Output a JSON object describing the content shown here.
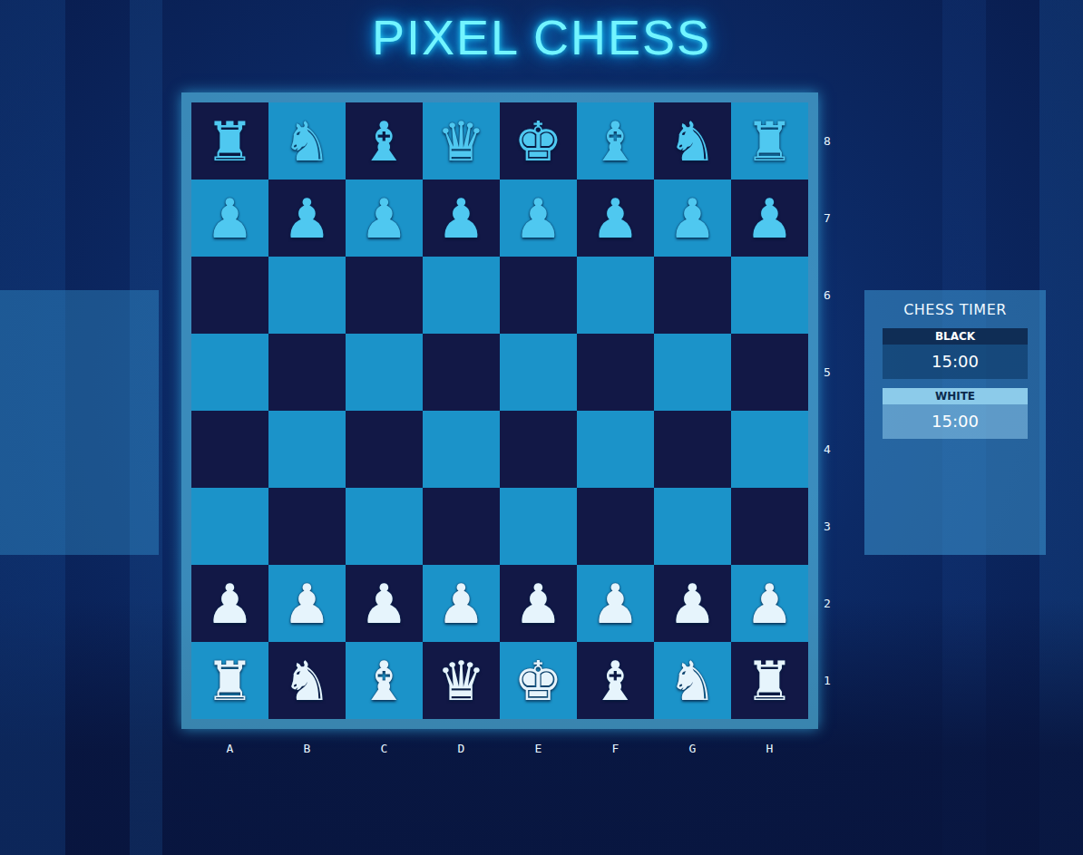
{
  "title": "PIXEL CHESS",
  "board": {
    "ranks": [
      {
        "label": "8",
        "squares": [
          {
            "piece": "♜",
            "color": "#4fc8f0"
          },
          {
            "piece": "♞",
            "color": "#4fc8f0"
          },
          {
            "piece": "♝",
            "color": "#4fc8f0"
          },
          {
            "piece": "♛",
            "color": "#4fc8f0"
          },
          {
            "piece": "♚",
            "color": "#4fc8f0"
          },
          {
            "piece": "♝",
            "color": "#4fc8f0"
          },
          {
            "piece": "♞",
            "color": "#4fc8f0"
          },
          {
            "piece": "♜",
            "color": "#4fc8f0"
          }
        ]
      },
      {
        "label": "7",
        "squares": [
          {
            "piece": "♟",
            "color": "#4fc8f0"
          },
          {
            "piece": "♟",
            "color": "#4fc8f0"
          },
          {
            "piece": "♟",
            "color": "#4fc8f0"
          },
          {
            "piece": "♟",
            "color": "#4fc8f0"
          },
          {
            "piece": "♟",
            "color": "#4fc8f0"
          },
          {
            "piece": "♟",
            "color": "#4fc8f0"
          },
          {
            "piece": "♟",
            "color": "#4fc8f0"
          },
          {
            "piece": "♟",
            "color": "#4fc8f0"
          }
        ]
      },
      {
        "label": "6",
        "squares": [
          {
            "piece": ""
          },
          {
            "piece": ""
          },
          {
            "piece": ""
          },
          {
            "piece": ""
          },
          {
            "piece": ""
          },
          {
            "piece": ""
          },
          {
            "piece": ""
          },
          {
            "piece": ""
          }
        ]
      },
      {
        "label": "5",
        "squares": [
          {
            "piece": ""
          },
          {
            "piece": ""
          },
          {
            "piece": ""
          },
          {
            "piece": ""
          },
          {
            "piece": ""
          },
          {
            "piece": ""
          },
          {
            "piece": ""
          },
          {
            "piece": ""
          }
        ]
      },
      {
        "label": "4",
        "squares": [
          {
            "piece": ""
          },
          {
            "piece": ""
          },
          {
            "piece": ""
          },
          {
            "piece": ""
          },
          {
            "piece": ""
          },
          {
            "piece": ""
          },
          {
            "piece": ""
          },
          {
            "piece": ""
          }
        ]
      },
      {
        "label": "3",
        "squares": [
          {
            "piece": ""
          },
          {
            "piece": ""
          },
          {
            "piece": ""
          },
          {
            "piece": ""
          },
          {
            "piece": ""
          },
          {
            "piece": ""
          },
          {
            "piece": ""
          },
          {
            "piece": ""
          }
        ]
      },
      {
        "label": "2",
        "squares": [
          {
            "piece": "♟",
            "color": "#e6f4fc"
          },
          {
            "piece": "♟",
            "color": "#e6f4fc"
          },
          {
            "piece": "♟",
            "color": "#e6f4fc"
          },
          {
            "piece": "♟",
            "color": "#e6f4fc"
          },
          {
            "piece": "♟",
            "color": "#e6f4fc"
          },
          {
            "piece": "♟",
            "color": "#e6f4fc"
          },
          {
            "piece": "♟",
            "color": "#e6f4fc"
          },
          {
            "piece": "♟",
            "color": "#e6f4fc"
          }
        ]
      },
      {
        "label": "1",
        "squares": [
          {
            "piece": "♜",
            "color": "#e6f4fc"
          },
          {
            "piece": "♞",
            "color": "#e6f4fc"
          },
          {
            "piece": "♝",
            "color": "#e6f4fc"
          },
          {
            "piece": "♛",
            "color": "#e6f4fc"
          },
          {
            "piece": "♚",
            "color": "#e6f4fc"
          },
          {
            "piece": "♝",
            "color": "#e6f4fc"
          },
          {
            "piece": "♞",
            "color": "#e6f4fc"
          },
          {
            "piece": "♜",
            "color": "#e6f4fc"
          }
        ]
      }
    ],
    "files": [
      "A",
      "B",
      "C",
      "D",
      "E",
      "F",
      "G",
      "H"
    ]
  },
  "timer": {
    "title": "CHESS TIMER",
    "players": [
      {
        "label": "BLACK",
        "time": "15:00",
        "color": "#0f2d55"
      },
      {
        "label": "WHITE",
        "time": "15:00",
        "color": "#8ccbea"
      }
    ]
  }
}
